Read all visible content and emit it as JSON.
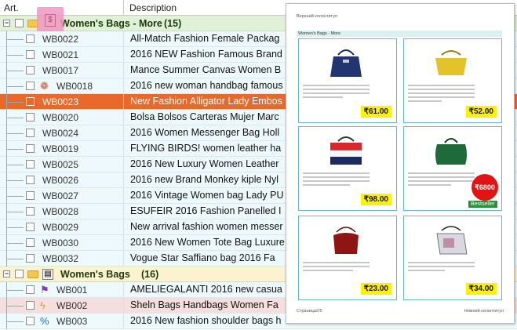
{
  "columns": {
    "art": "Art.",
    "description": "Description"
  },
  "groups": [
    {
      "name": "Women's Bags - More",
      "count": "(15)"
    },
    {
      "name": "Women's Bags",
      "count": "(16)"
    }
  ],
  "rows": [
    {
      "art": "WB0022",
      "desc": "All-Match Fashion Female Packag"
    },
    {
      "art": "WB0021",
      "desc": "2016 NEW Fashion Famous Brand"
    },
    {
      "art": "WB0017",
      "desc": "Mance Summer Canvas Women B"
    },
    {
      "art": "WB0018",
      "desc": "2016 new woman handbag famous"
    },
    {
      "art": "WB0023",
      "desc": "New Fashion Alligator Lady Embos"
    },
    {
      "art": "WB0020",
      "desc": "Bolsa Bolsos Carteras Mujer Marc"
    },
    {
      "art": "WB0024",
      "desc": "2016 Women Messenger Bag Holl"
    },
    {
      "art": "WB0019",
      "desc": "FLYING BIRDS! women leather ha"
    },
    {
      "art": "WB0025",
      "desc": "2016 New Luxury Women Leather"
    },
    {
      "art": "WB0026",
      "desc": "2016 new Brand Monkey kiple Nyl"
    },
    {
      "art": "WB0027",
      "desc": "2016 Vintage Women bag Lady PU"
    },
    {
      "art": "WB0028",
      "desc": "ESUFEIR 2016 Fashion Panelled I"
    },
    {
      "art": "WB0029",
      "desc": "New arrival fashion women messer"
    },
    {
      "art": "WB0030",
      "desc": "2016 New Women Tote Bag Luxure"
    },
    {
      "art": "WB0032",
      "desc": "Vogue Star Saffiano bag 2016 Fa"
    }
  ],
  "rows2": [
    {
      "art": "WB001",
      "desc": "AMELIEGALANTI 2016 new casua"
    },
    {
      "art": "WB002",
      "desc": "Sheln Bags Handbags Women Fa"
    },
    {
      "art": "WB003",
      "desc": "2016 New fashion shoulder bags h"
    }
  ],
  "preview": {
    "header": "Верхний колонтитул",
    "group_title": "Women's Bags - More",
    "footer_left": "Страница2/5",
    "footer_right": "Нижний колонтитул",
    "prices": [
      "₹61.00",
      "₹52.00",
      "₹98.00",
      "₹18.00",
      "₹23.00",
      "₹34.00"
    ],
    "badge": "₹6800",
    "bestseller": "Bestseller"
  },
  "colors": {
    "selected": "#e8692b",
    "group1": "#dff1d6",
    "group2": "#fbf3cf",
    "price": "#fff200"
  }
}
